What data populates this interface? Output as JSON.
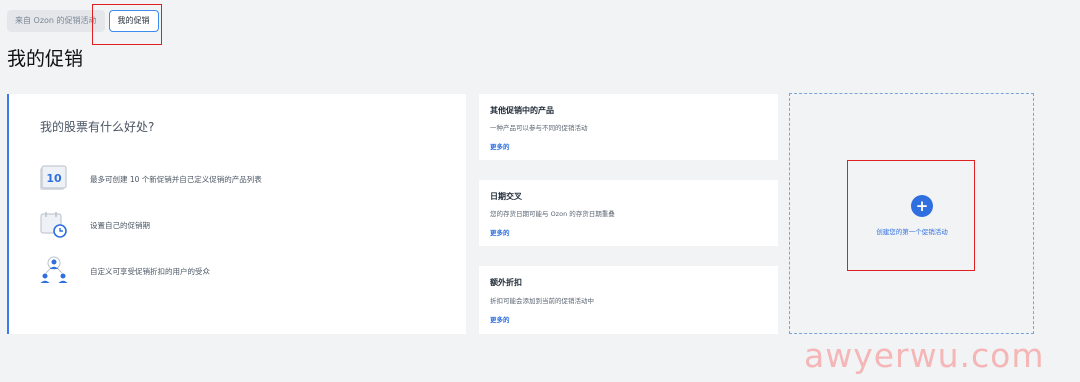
{
  "tabs": [
    {
      "label": "来自 Ozon 的促销活动"
    },
    {
      "label": "我的促销"
    }
  ],
  "page_title": "我的促销",
  "benefits": {
    "title": "我的股票有什么好处?",
    "items": [
      {
        "icon": "calendar-10-icon",
        "icon_text": "10",
        "text": "最多可创建 10 个新促销并自己定义促销的产品列表"
      },
      {
        "icon": "calendar-clock-icon",
        "text": "设置自己的促销期"
      },
      {
        "icon": "audience-icon",
        "text": "自定义可享受促销折扣的用户的受众"
      }
    ]
  },
  "info_cards": [
    {
      "title": "其他促销中的产品",
      "desc": "一种产品可以参与不同的促销活动",
      "more": "更多的"
    },
    {
      "title": "日期交叉",
      "desc": "您的存货日期可能与 Ozon 的存货日期重叠",
      "more": "更多的"
    },
    {
      "title": "额外折扣",
      "desc": "折扣可能会添加到当前的促销活动中",
      "more": "更多的"
    }
  ],
  "create": {
    "icon": "plus-icon",
    "label": "创建您的第一个促销活动"
  },
  "watermark": "awyerwu.com",
  "colors": {
    "accent": "#2f6fe0",
    "highlight": "#e02020"
  }
}
